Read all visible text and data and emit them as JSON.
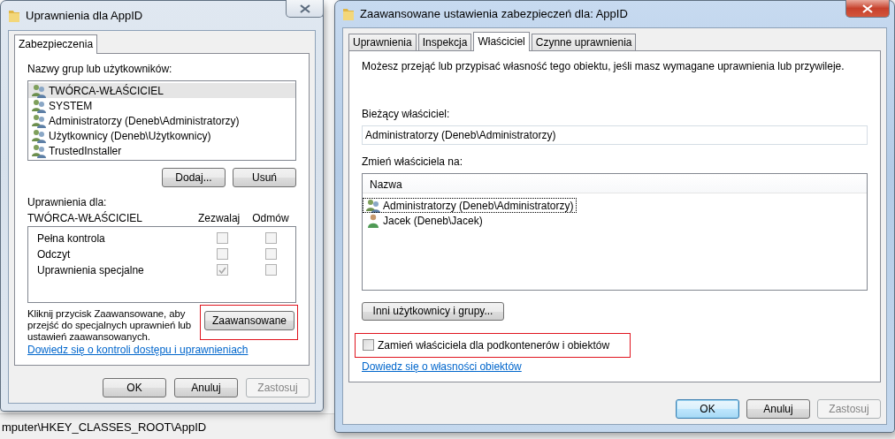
{
  "background": {
    "status_path": "mputer\\HKEY_CLASSES_ROOT\\AppID"
  },
  "permissions_dialog": {
    "title": "Uprawnienia dla AppID",
    "active": false,
    "tabs": [
      {
        "label": "Zabezpieczenia",
        "selected": true
      }
    ],
    "groups_label": "Nazwy grup lub użytkowników:",
    "groups": [
      {
        "name": "TWÓRCA-WŁAŚCICIEL",
        "kind": "group",
        "selected": true
      },
      {
        "name": "SYSTEM",
        "kind": "group",
        "selected": false
      },
      {
        "name": "Administratorzy (Deneb\\Administratorzy)",
        "kind": "group",
        "selected": false
      },
      {
        "name": "Użytkownicy (Deneb\\Użytkownicy)",
        "kind": "group",
        "selected": false
      },
      {
        "name": "TrustedInstaller",
        "kind": "group",
        "selected": false
      }
    ],
    "add_button": "Dodaj...",
    "remove_button": "Usuń",
    "permissions_for_label": "Uprawnienia dla:",
    "permissions_for_name": "TWÓRCA-WŁAŚCICIEL",
    "allow_header": "Zezwalaj",
    "deny_header": "Odmów",
    "permissions": [
      {
        "name": "Pełna kontrola",
        "allow": false,
        "deny": false
      },
      {
        "name": "Odczyt",
        "allow": false,
        "deny": false
      },
      {
        "name": "Uprawnienia specjalne",
        "allow": true,
        "deny": false
      }
    ],
    "hint": "Kliknij przycisk Zaawansowane, aby przejść do specjalnych uprawnień lub ustawień zaawansowanych.",
    "advanced_button": {
      "label": "Zaawansowane",
      "highlighted": true
    },
    "help_link": "Dowiedz się o kontroli dostępu i uprawnieniach",
    "buttons": [
      {
        "label": "OK",
        "default": false,
        "disabled": false
      },
      {
        "label": "Anuluj",
        "default": false,
        "disabled": false
      },
      {
        "label": "Zastosuj",
        "default": false,
        "disabled": true
      }
    ]
  },
  "advanced_dialog": {
    "title": "Zaawansowane ustawienia zabezpieczeń dla: AppID",
    "active": true,
    "tabs": [
      {
        "label": "Uprawnienia",
        "selected": false
      },
      {
        "label": "Inspekcja",
        "selected": false
      },
      {
        "label": "Właściciel",
        "selected": true
      },
      {
        "label": "Czynne uprawnienia",
        "selected": false
      }
    ],
    "description": "Możesz przejąć lub przypisać własność tego obiektu, jeśli masz wymagane uprawnienia lub przywileje.",
    "current_owner_label": "Bieżący właściciel:",
    "current_owner": "Administratorzy (Deneb\\Administratorzy)",
    "change_owner_label": "Zmień właściciela na:",
    "list_header": "Nazwa",
    "owners": [
      {
        "name": "Administratorzy (Deneb\\Administratorzy)",
        "kind": "group",
        "selected": true
      },
      {
        "name": "Jacek (Deneb\\Jacek)",
        "kind": "user",
        "selected": false
      }
    ],
    "other_users_button": "Inni użytkownicy i grupy...",
    "replace_owner": {
      "label": "Zamień właściciela dla podkontenerów i obiektów",
      "checked": false,
      "highlighted": true
    },
    "help_link": "Dowiedz się o własności obiektów",
    "buttons": [
      {
        "label": "OK",
        "default": true,
        "disabled": false
      },
      {
        "label": "Anuluj",
        "default": false,
        "disabled": false
      },
      {
        "label": "Zastosuj",
        "default": false,
        "disabled": true
      }
    ]
  }
}
